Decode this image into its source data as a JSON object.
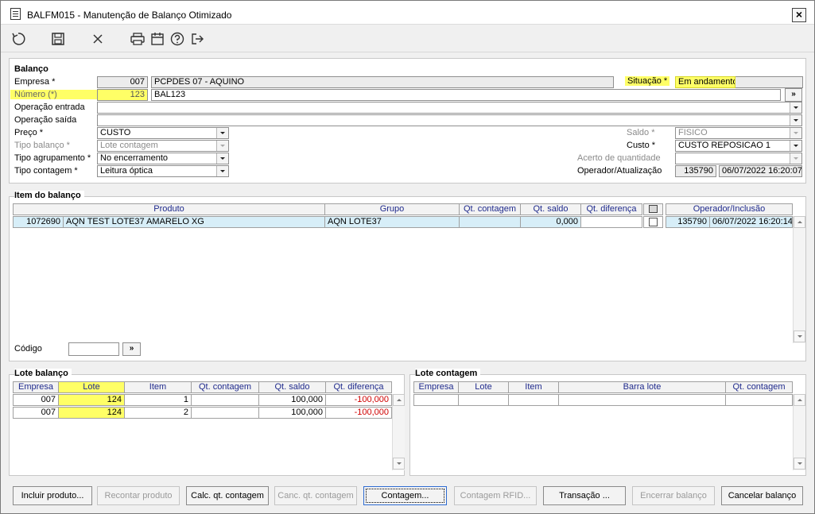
{
  "window": {
    "title": "BALFM015 - Manutenção de Balanço Otimizado",
    "close_label": "×"
  },
  "toolbar": {
    "icons": [
      "refresh-icon",
      "save-icon",
      "cancel-icon",
      "print-icon",
      "calendar-icon",
      "help-icon",
      "exit-icon"
    ]
  },
  "header": {
    "section_title": "Balanço",
    "empresa": {
      "label": "Empresa *",
      "code": "007",
      "name": "PCPDES 07 - AQUINO"
    },
    "situacao": {
      "label": "Situação *",
      "value": "Em andamento"
    },
    "numero": {
      "label": "Número (*)",
      "value": "123",
      "desc": "BAL123",
      "button": "»"
    },
    "operacao_entrada": {
      "label": "Operação entrada",
      "value": ""
    },
    "operacao_saida": {
      "label": "Operação saída",
      "value": ""
    },
    "preco": {
      "label": "Preço *",
      "value": "CUSTO"
    },
    "saldo": {
      "label": "Saldo *",
      "value": "FISICO"
    },
    "tipo_balanco": {
      "label": "Tipo balanço *",
      "value": "Lote contagem"
    },
    "custo": {
      "label": "Custo *",
      "value": "CUSTO REPOSICAO 1"
    },
    "tipo_agrupamento": {
      "label": "Tipo agrupamento *",
      "value": "No encerramento"
    },
    "acerto": {
      "label": "Acerto de quantidade",
      "value": ""
    },
    "tipo_contagem": {
      "label": "Tipo contagem *",
      "value": "Leitura óptica"
    },
    "operador": {
      "label": "Operador/Atualização",
      "code": "135790",
      "date": "06/07/2022 16:20:07"
    }
  },
  "item_balanco": {
    "section_title": "Item do balanço",
    "columns": [
      "Produto",
      "Grupo",
      "Qt. contagem",
      "Qt. saldo",
      "Qt. diferença",
      "Operador/Inclusão"
    ],
    "rows": [
      {
        "code": "1072690",
        "produto": "AQN TEST LOTE37 AMARELO XG",
        "grupo": "AQN LOTE37",
        "qt_contagem": "",
        "qt_saldo": "0,000",
        "qt_diferenca": "",
        "operador": "135790",
        "inclusao": "06/07/2022 16:20:14"
      }
    ],
    "codigo_label": "Código",
    "codigo_value": "",
    "codigo_button": "»"
  },
  "lote_balanco": {
    "section_title": "Lote balanço",
    "columns": [
      "Empresa",
      "Lote",
      "Item",
      "Qt. contagem",
      "Qt. saldo",
      "Qt. diferença"
    ],
    "rows": [
      {
        "empresa": "007",
        "lote": "124",
        "item": "1",
        "qt_contagem": "",
        "qt_saldo": "100,000",
        "qt_diferenca": "-100,000"
      },
      {
        "empresa": "007",
        "lote": "124",
        "item": "2",
        "qt_contagem": "",
        "qt_saldo": "100,000",
        "qt_diferenca": "-100,000"
      }
    ]
  },
  "lote_contagem": {
    "section_title": "Lote contagem",
    "columns": [
      "Empresa",
      "Lote",
      "Item",
      "Barra lote",
      "Qt. contagem"
    ]
  },
  "buttons": {
    "incluir": "Incluir produto...",
    "recontar": "Recontar produto",
    "calc": "Calc. qt. contagem",
    "canc": "Canc. qt. contagem",
    "contagem": "Contagem...",
    "contagem_rfid": "Contagem RFID...",
    "transacao": "Transação ...",
    "encerrar": "Encerrar balanço",
    "cancelar": "Cancelar balanço"
  },
  "colors": {
    "highlight": "#ffff66",
    "header_text": "#1f2a8c",
    "negative": "#d00000",
    "selected_row": "#d7eef8"
  }
}
